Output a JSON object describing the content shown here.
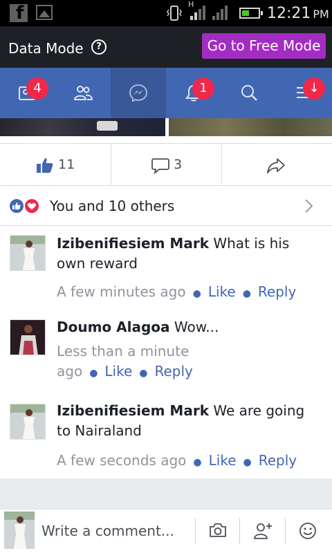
{
  "status_bar": {
    "time": "12:21",
    "ampm": "PM",
    "network_type": "H",
    "icons": [
      "facebook-icon",
      "image-icon",
      "vibrate-icon",
      "signal-icon",
      "signal-icon",
      "battery-icon"
    ]
  },
  "data_mode": {
    "label": "Data Mode",
    "help_glyph": "?",
    "button_label": "Go to Free Mode"
  },
  "nav": {
    "tabs": [
      {
        "name": "friend-requests",
        "icon": "friend-requests-icon",
        "badge": "4"
      },
      {
        "name": "friends",
        "icon": "friends-icon",
        "badge": ""
      },
      {
        "name": "messenger",
        "icon": "messenger-icon",
        "badge": ""
      },
      {
        "name": "notifications",
        "icon": "bell-icon",
        "badge": "1"
      },
      {
        "name": "search",
        "icon": "search-icon",
        "badge": ""
      },
      {
        "name": "menu",
        "icon": "menu-icon",
        "badge": "↓"
      }
    ],
    "active_tab": "messenger"
  },
  "actions": {
    "likes": "11",
    "comments": "3"
  },
  "reactions": {
    "summary": "You and 10 others"
  },
  "comments": [
    {
      "author": "Izibenifiesiem Mark",
      "text": "What is his own reward",
      "time": "A few minutes ago",
      "like": "Like",
      "reply": "Reply"
    },
    {
      "author": "Doumo Alagoa",
      "text": "Wow...",
      "time": "Less than a minute ago",
      "like": "Like",
      "reply": "Reply"
    },
    {
      "author": "Izibenifiesiem Mark",
      "text": "We are going to Nairaland",
      "time": "A few seconds ago",
      "like": "Like",
      "reply": "Reply"
    }
  ],
  "composer": {
    "placeholder": "Write a comment..."
  },
  "colors": {
    "facebook_blue": "#4267b2",
    "active_tab": "#385898",
    "badge_red": "#f02849",
    "free_mode_purple": "#a32cc3",
    "meta_gray": "#90949c"
  }
}
